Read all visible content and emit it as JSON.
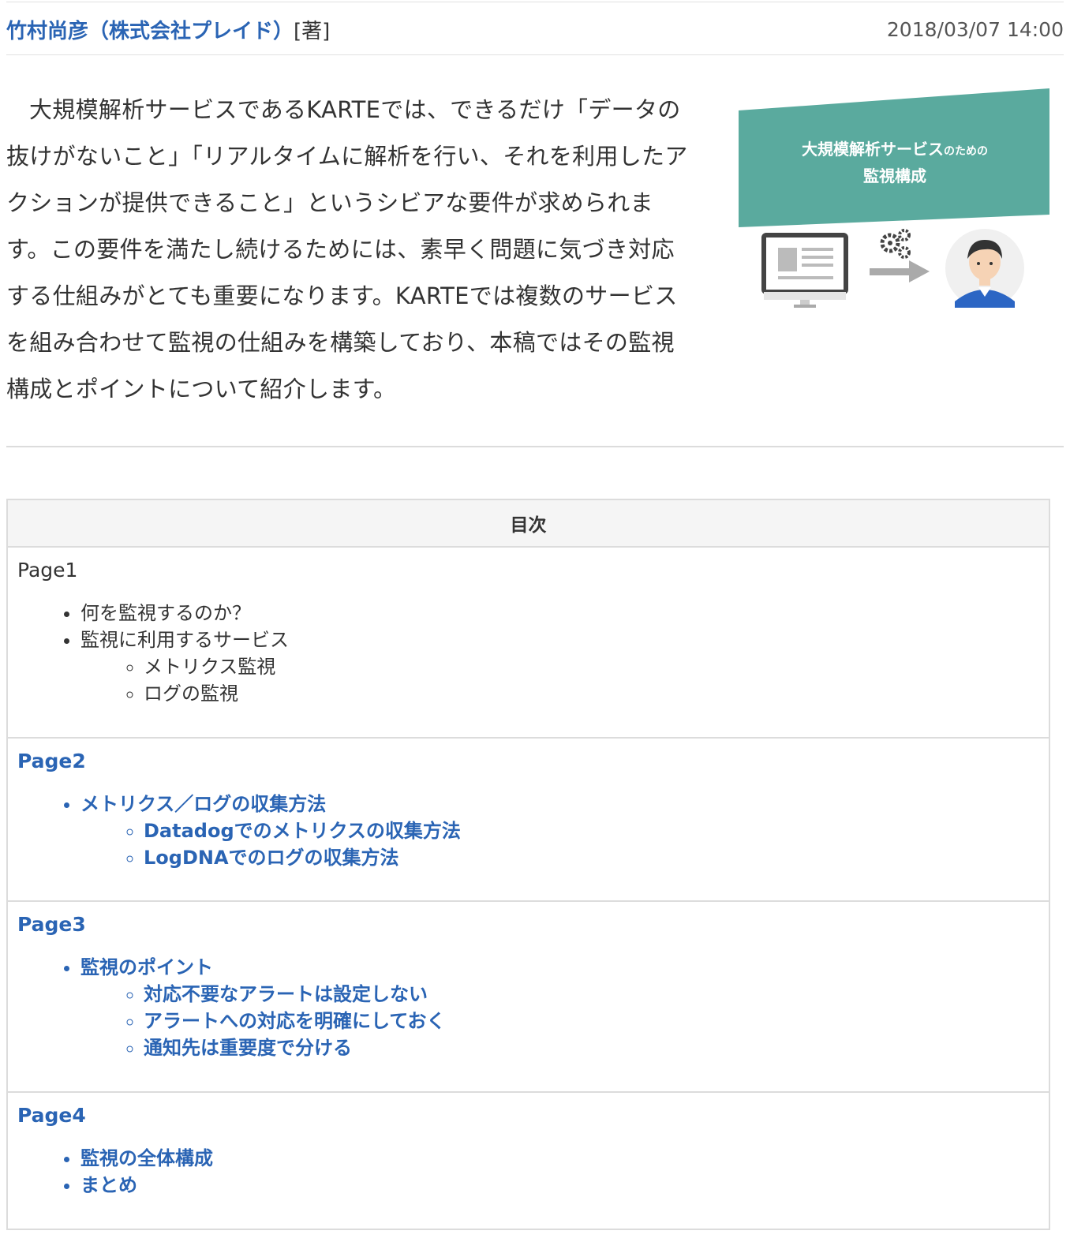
{
  "header": {
    "author": "竹村尚彦（株式会社プレイド）",
    "author_role": "[著]",
    "date": "2018/03/07 14:00"
  },
  "lead": {
    "text": "大規模解析サービスであるKARTEでは、できるだけ「データの抜けがないこと」「リアルタイムに解析を行い、それを利用したアクションが提供できること」というシビアな要件が求められます。この要件を満たし続けるためには、素早く問題に気づき対応する仕組みがとても重要になります。KARTEでは複数のサービスを組み合わせて監視の仕組みを構築しており、本稿ではその監視構成とポイントについて紹介します。"
  },
  "hero": {
    "title_line1_main": "大規模解析サービス",
    "title_line1_small": "のための",
    "title_line2": "監視構成",
    "banner_color": "#5aaa9e",
    "icons": [
      "monitor-icon",
      "gears-icon",
      "arrow-right-icon",
      "person-avatar-icon"
    ]
  },
  "toc": {
    "title": "目次",
    "pages": [
      {
        "label": "Page1",
        "items": [
          {
            "label": "何を監視するのか？",
            "children": []
          },
          {
            "label": "監視に利用するサービス",
            "children": [
              "メトリクス監視",
              "ログの監視"
            ]
          }
        ]
      },
      {
        "label": "Page2",
        "items": [
          {
            "label": "メトリクス／ログの収集方法",
            "children": [
              "Datadogでのメトリクスの収集方法",
              "LogDNAでのログの収集方法"
            ]
          }
        ]
      },
      {
        "label": "Page3",
        "items": [
          {
            "label": "監視のポイント",
            "children": [
              "対応不要なアラートは設定しない",
              "アラートへの対応を明確にしておく",
              "通知先は重要度で分ける"
            ]
          }
        ]
      },
      {
        "label": "Page4",
        "items": [
          {
            "label": "監視の全体構成",
            "children": []
          },
          {
            "label": "まとめ",
            "children": []
          }
        ]
      }
    ]
  },
  "colors": {
    "link": "#2a64b4",
    "text": "#333333",
    "border": "#dcdcdc",
    "toc_head_bg": "#f5f5f5"
  }
}
